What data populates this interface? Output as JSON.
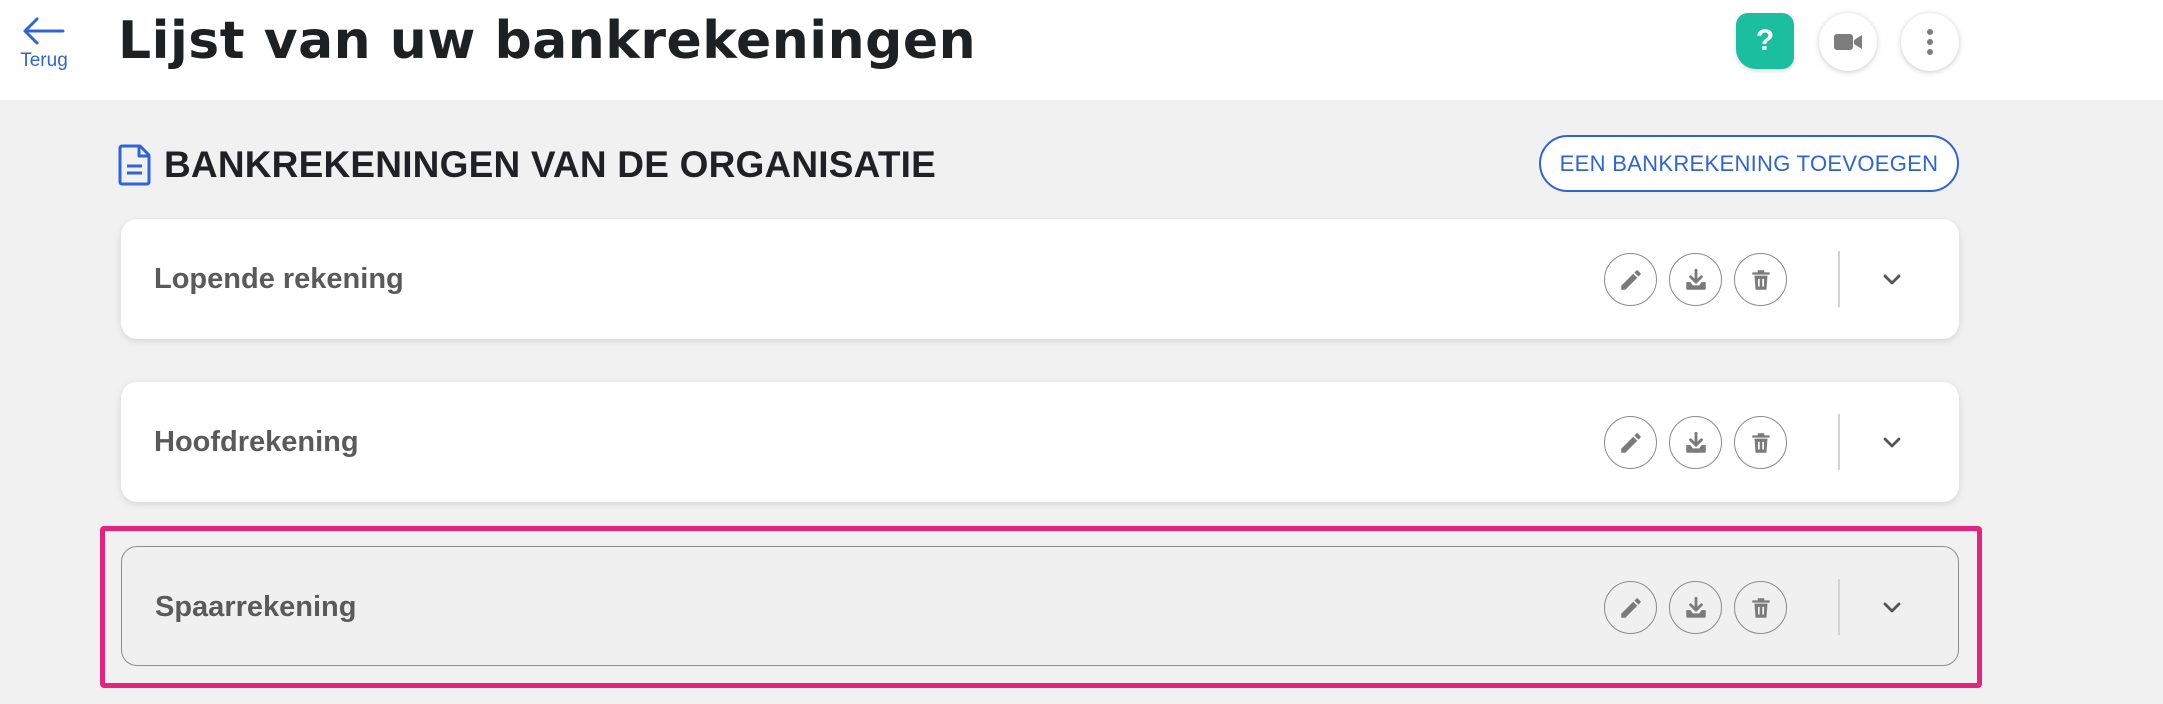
{
  "header": {
    "back_label": "Terug",
    "title": "Lijst van uw bankrekeningen",
    "help_label": "?",
    "help_color": "#1bbf9f",
    "video_icon": "video-camera-icon",
    "more_icon": "more-vertical-icon"
  },
  "section": {
    "title": "BANKREKENINGEN VAN DE ORGANISATIE",
    "icon": "document-icon",
    "add_button_label": "EEN BANKREKENING TOEVOEGEN"
  },
  "accounts": [
    {
      "name": "Lopende rekening"
    },
    {
      "name": "Hoofdrekening"
    },
    {
      "name": "Spaarrekening",
      "highlighted": true
    }
  ],
  "row_actions": [
    "edit-icon",
    "download-icon",
    "delete-icon",
    "chevron-down-icon"
  ],
  "colors": {
    "accent": "#2f63d8",
    "highlight": "#e8237d"
  }
}
